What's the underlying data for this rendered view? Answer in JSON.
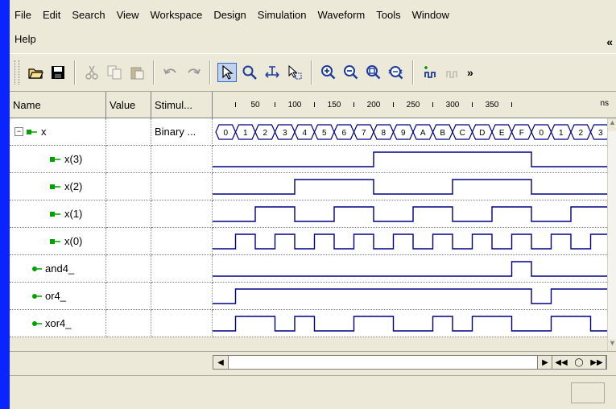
{
  "menu": {
    "row1": [
      "File",
      "Edit",
      "Search",
      "View",
      "Workspace",
      "Design",
      "Simulation",
      "Waveform",
      "Tools",
      "Window"
    ],
    "row2": [
      "Help"
    ],
    "overflow": "«"
  },
  "toolbar": {
    "more": "»",
    "icons": [
      "open-folder-icon",
      "save-icon",
      "cut-icon",
      "copy-icon",
      "paste-icon",
      "undo-icon",
      "redo-icon",
      "pointer-icon",
      "zoom-icon",
      "measure-icon",
      "select-region-icon",
      "zoom-in-icon",
      "zoom-out-icon",
      "zoom-fit-icon",
      "zoom-full-icon",
      "add-signal-icon",
      "edit-signal-icon"
    ]
  },
  "grid": {
    "headers": {
      "name": "Name",
      "value": "Value",
      "stimulator": "Stimul...",
      "units": "ns"
    },
    "ticks": [
      "50",
      "100",
      "150",
      "200",
      "250",
      "300",
      "350"
    ],
    "bus_values": [
      "0",
      "1",
      "2",
      "3",
      "4",
      "5",
      "6",
      "7",
      "8",
      "9",
      "A",
      "B",
      "C",
      "D",
      "E",
      "F",
      "0",
      "1",
      "2",
      "3"
    ],
    "rows": [
      {
        "name": "x",
        "value": "",
        "stim": "Binary ...",
        "type": "bus",
        "expanded": true
      },
      {
        "name": "x(3)",
        "value": "",
        "stim": "",
        "type": "input"
      },
      {
        "name": "x(2)",
        "value": "",
        "stim": "",
        "type": "input"
      },
      {
        "name": "x(1)",
        "value": "",
        "stim": "",
        "type": "input"
      },
      {
        "name": "x(0)",
        "value": "",
        "stim": "",
        "type": "input"
      },
      {
        "name": "and4_",
        "value": "",
        "stim": "",
        "type": "output"
      },
      {
        "name": "or4_",
        "value": "",
        "stim": "",
        "type": "output"
      },
      {
        "name": "xor4_",
        "value": "",
        "stim": "",
        "type": "output"
      }
    ]
  },
  "colors": {
    "title_blue": "#0a24ff",
    "wave": "#000080",
    "selection": "#316ac5",
    "input_arrow": "#00a000"
  }
}
